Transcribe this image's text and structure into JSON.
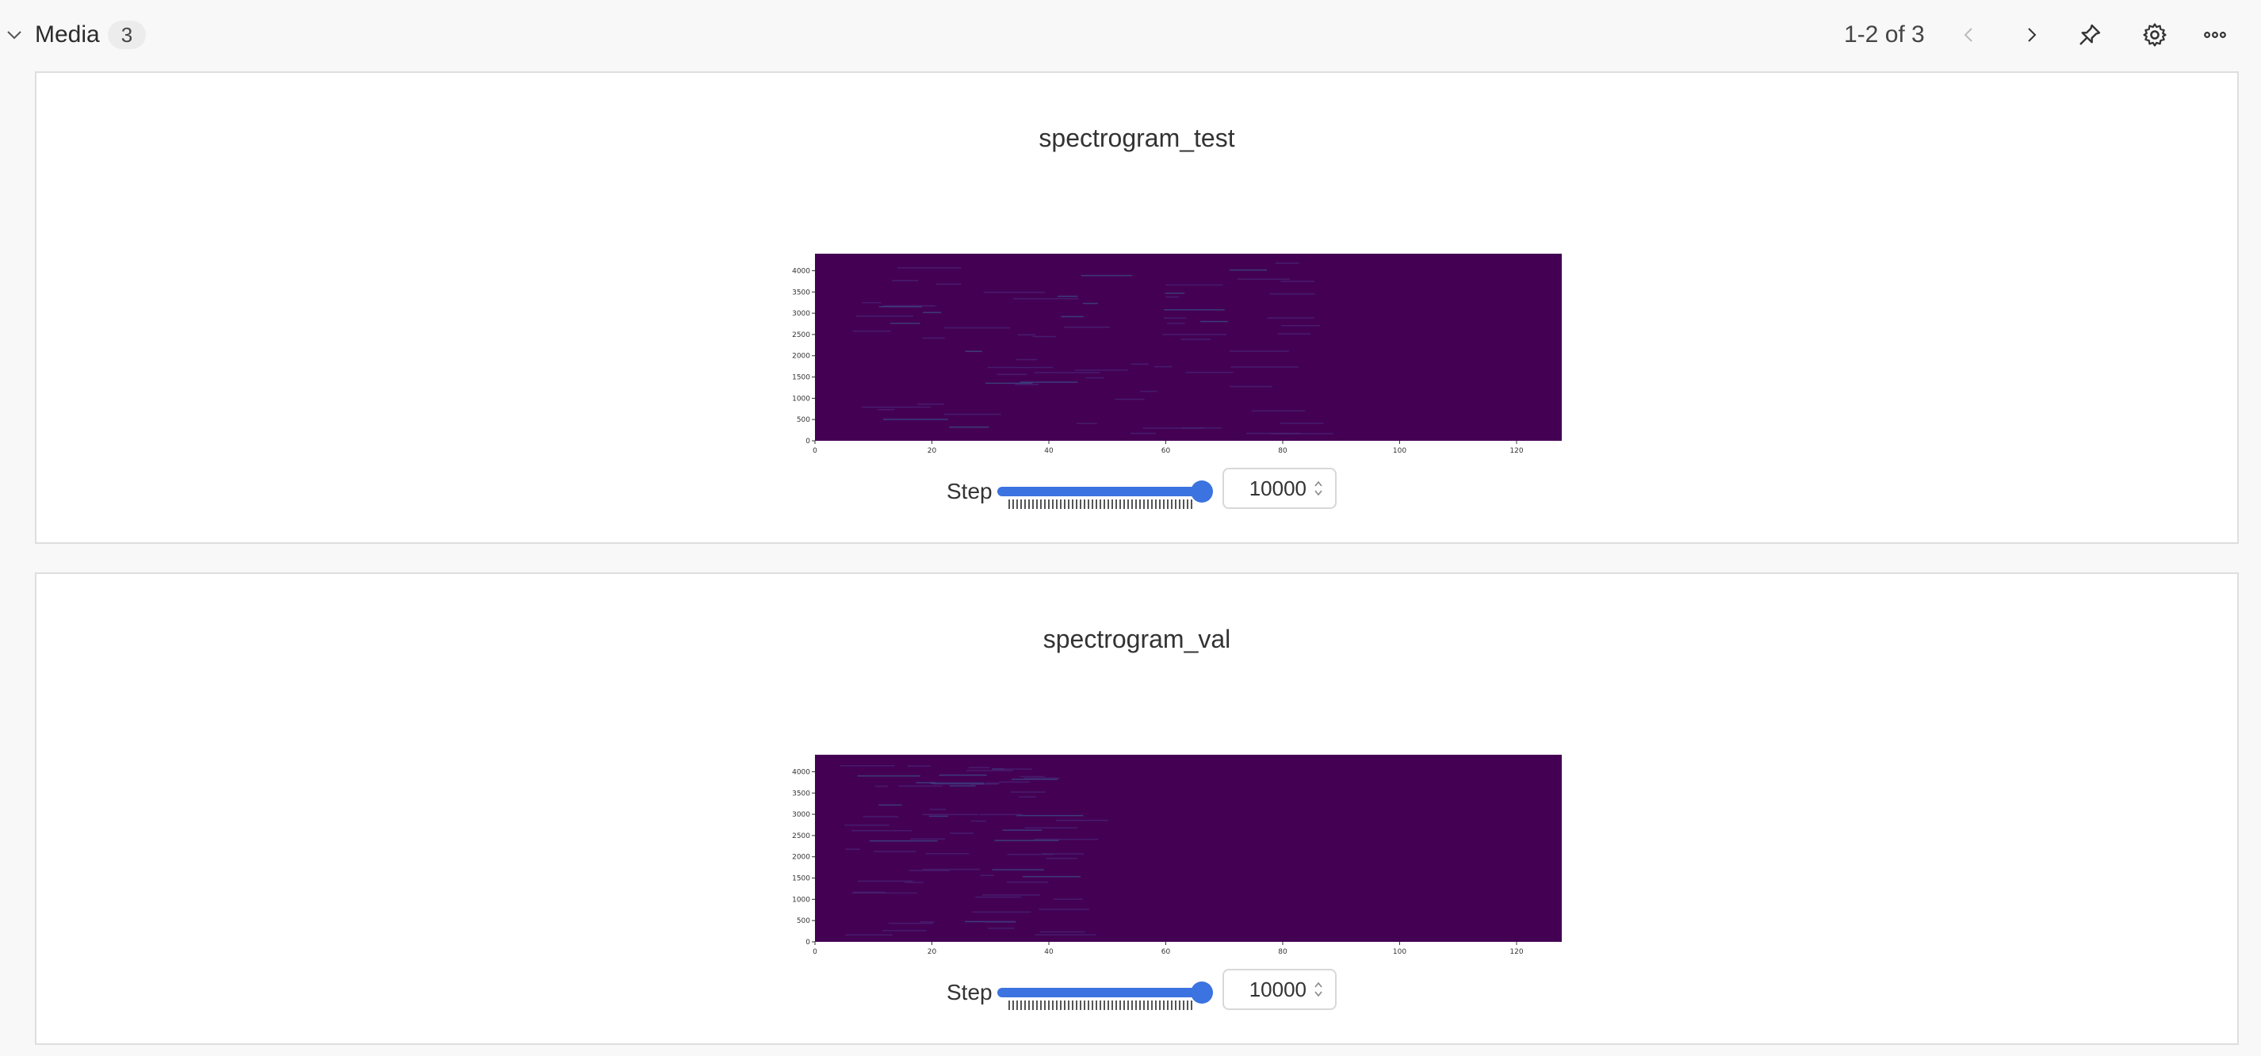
{
  "section": {
    "title": "Media",
    "count": "3"
  },
  "pagination": {
    "text": "1-2 of 3"
  },
  "icons": {
    "collapse": "chevron-down-icon",
    "prev": "chevron-left-icon",
    "next": "chevron-right-icon",
    "pin": "pin-icon",
    "settings": "gear-icon",
    "more": "more-icon"
  },
  "colors": {
    "accent": "#3b73e0",
    "heatmap_background": "#440154"
  },
  "panels": [
    {
      "title": "spectrogram_test",
      "step_label": "Step",
      "step_value": "10000",
      "slider_fraction": 1.0,
      "chart_data": {
        "type": "heatmap",
        "x_ticks": [
          "0",
          "20",
          "40",
          "60",
          "80",
          "100",
          "120"
        ],
        "y_ticks": [
          "0",
          "500",
          "1000",
          "1500",
          "2000",
          "2500",
          "3000",
          "3500",
          "4000"
        ],
        "xlim": [
          0,
          128
        ],
        "ylim": [
          0,
          4400
        ]
      }
    },
    {
      "title": "spectrogram_val",
      "step_label": "Step",
      "step_value": "10000",
      "slider_fraction": 1.0,
      "chart_data": {
        "type": "heatmap",
        "x_ticks": [
          "0",
          "20",
          "40",
          "60",
          "80",
          "100",
          "120"
        ],
        "y_ticks": [
          "0",
          "500",
          "1000",
          "1500",
          "2000",
          "2500",
          "3000",
          "3500",
          "4000"
        ],
        "xlim": [
          0,
          128
        ],
        "ylim": [
          0,
          4400
        ]
      }
    }
  ]
}
